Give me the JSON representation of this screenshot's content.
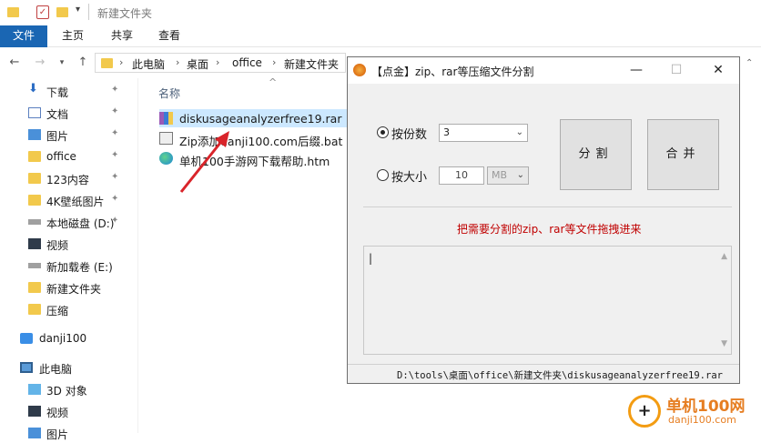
{
  "window": {
    "title": "新建文件夹"
  },
  "ribbon": {
    "tabs": [
      "文件",
      "主页",
      "共享",
      "查看"
    ]
  },
  "address": {
    "crumbs": [
      "此电脑",
      "桌面",
      "office",
      "新建文件夹"
    ],
    "up_arrow": "^"
  },
  "sidebar": {
    "items": [
      {
        "label": "下载",
        "icon": "download-icon",
        "pinned": true
      },
      {
        "label": "文档",
        "icon": "document-icon",
        "pinned": true
      },
      {
        "label": "图片",
        "icon": "picture-icon",
        "pinned": true
      },
      {
        "label": "office",
        "icon": "folder-icon",
        "pinned": true
      },
      {
        "label": "123内容",
        "icon": "folder-icon",
        "pinned": true
      },
      {
        "label": "4K壁纸图片",
        "icon": "folder-icon",
        "pinned": true
      },
      {
        "label": "本地磁盘 (D:)",
        "icon": "drive-icon",
        "pinned": true
      },
      {
        "label": "视频",
        "icon": "video-icon",
        "pinned": false
      },
      {
        "label": "新加载卷 (E:)",
        "icon": "drive-icon",
        "pinned": false
      },
      {
        "label": "新建文件夹",
        "icon": "folder-icon",
        "pinned": false
      },
      {
        "label": "压缩",
        "icon": "folder-icon",
        "pinned": false
      },
      {
        "label": "danji100",
        "icon": "cloud-icon",
        "pinned": false
      },
      {
        "label": "此电脑",
        "icon": "computer-icon",
        "pinned": false
      },
      {
        "label": "3D 对象",
        "icon": "3d-icon",
        "pinned": false
      },
      {
        "label": "视频",
        "icon": "video-icon",
        "pinned": false
      },
      {
        "label": "图片",
        "icon": "picture-icon",
        "pinned": false
      }
    ]
  },
  "list": {
    "column_name": "名称",
    "files": [
      {
        "name": "diskusageanalyzerfree19.rar",
        "icon": "rar-icon"
      },
      {
        "name": "Zip添加danji100.com后缀.bat",
        "icon": "bat-icon"
      },
      {
        "name": "单机100手游网下载帮助.htm",
        "icon": "edge-icon"
      }
    ]
  },
  "dialog": {
    "title": "【点金】zip、rar等压缩文件分割",
    "by_count_label": "按份数",
    "by_count_value": "3",
    "by_size_label": "按大小",
    "size_value": "10",
    "size_unit": "MB",
    "split_button": "分割",
    "merge_button": "合并",
    "hint": "把需要分割的zip、rar等文件拖拽进来",
    "log_text": "|",
    "status_path": "D:\\tools\\桌面\\office\\新建文件夹\\diskusageanalyzerfree19.rar",
    "minimize": "—",
    "maximize": "☐",
    "close": "✕"
  },
  "watermark": {
    "site_name": "单机100网",
    "site_url": "danji100.com"
  },
  "colors": {
    "accent": "#1a66b3",
    "hint": "#c00000",
    "arrow": "#d9242a"
  }
}
